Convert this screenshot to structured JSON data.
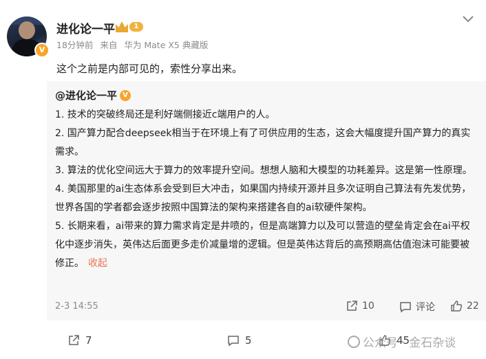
{
  "post": {
    "username": "进化论一平",
    "level_badge": "1",
    "meta": {
      "time": "18分钟前",
      "source_prefix": "来自",
      "device": "华为 Mate X5 典藏版"
    },
    "text": "这个之前是内部可见的，索性分享出来。"
  },
  "repost": {
    "author": "@进化论一平",
    "paragraphs": [
      "1. 技术的突破终局还是利好端侧接近c端用户的人。",
      "2. 国产算力配合deepseek相当于在环境上有了可供应用的生态，这会大幅度提升国产算力的真实需求。",
      "3. 算法的优化空间远大于算力的效率提升空间。想想人脑和大模型的功耗差异。这是第一性原理。",
      "4. 美国那里的ai生态体系会受到巨大冲击，如果国内持续开源并且多次证明自己算法有先发优势，世界各国的学者都会逐步按照中国算法的架构来搭建各自的ai软硬件架构。",
      "5. 长期来看，ai带来的算力需求肯定是井喷的，但是高端算力以及可以营造的壁垒肯定会在ai平权化中逐步消失，英伟达后面更多走价减量增的逻辑。但是英伟达背后的高预期高估值泡沫可能要被修正。"
    ],
    "collapse_label": "收起",
    "time": "2-3 14:55",
    "repost_count": "10",
    "comment_label": "评论",
    "like_count": "22"
  },
  "actions": {
    "repost_count": "7",
    "comment_count": "5",
    "like_count": "45"
  },
  "watermark": "公众号 · 金石杂谈",
  "colors": {
    "accent": "#eb7350",
    "badge": "#f6a52a",
    "muted": "#8b8b8b",
    "repost_bg": "#f7f7f7"
  }
}
